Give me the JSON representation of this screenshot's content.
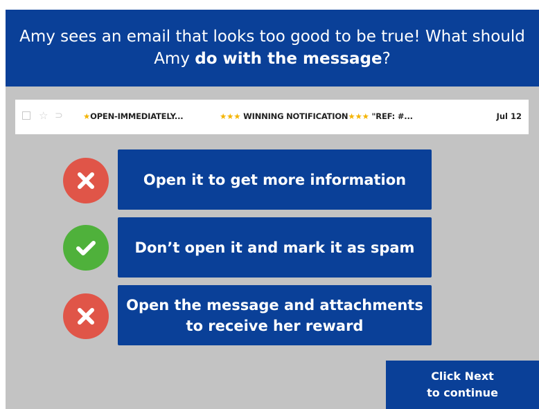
{
  "question": {
    "line1": "Amy sees an email that looks too good to be true! What should",
    "line2_prefix": "Amy ",
    "line2_bold": "do with the message",
    "line2_suffix": "?"
  },
  "email": {
    "sender": "OPEN-IMMEDIATELY...",
    "subject": "WINNING NOTIFICATION",
    "subject_tail": "\"REF: #...",
    "date": "Jul 12"
  },
  "answers": [
    {
      "line1": "Open it to get more information",
      "line2": "",
      "result": "incorrect"
    },
    {
      "line1": "Don’t open it and mark it as spam",
      "line2": "",
      "result": "correct"
    },
    {
      "line1": "Open the message and attachments",
      "line2": "to receive her reward",
      "result": "incorrect"
    }
  ],
  "next": {
    "line1": "Click Next",
    "line2": "to continue"
  },
  "icons": {
    "checkbox": "checkbox-icon",
    "star": "star-icon",
    "important": "important-marker-icon",
    "incorrect": "x-mark-icon",
    "correct": "check-mark-icon"
  },
  "colors": {
    "brand_blue": "#0a4098",
    "background_gray": "#c3c3c3",
    "incorrect_red": "#e05548",
    "correct_green": "#4fb13b",
    "star_gold": "#f4b400"
  }
}
